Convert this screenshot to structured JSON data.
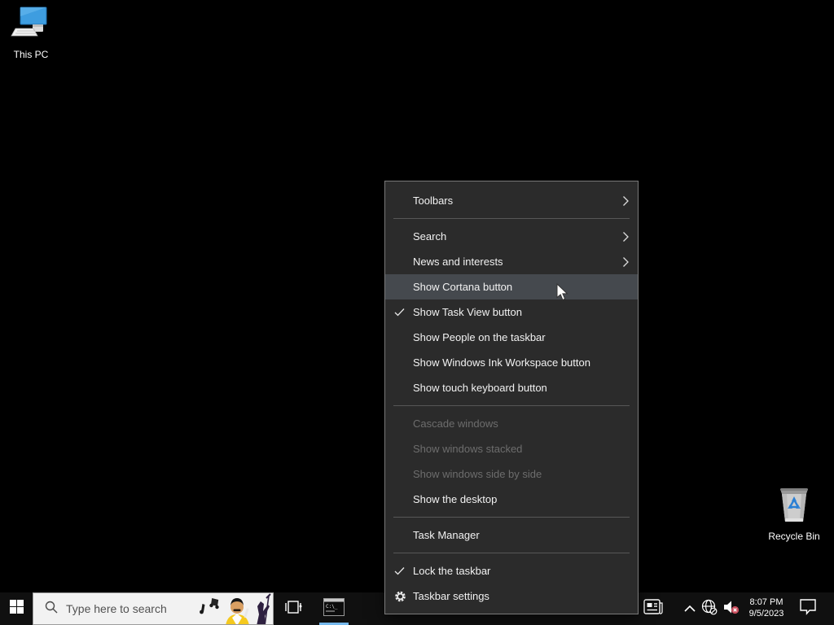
{
  "desktop": {
    "icons": [
      {
        "name": "this-pc",
        "label": "This PC"
      },
      {
        "name": "recycle-bin",
        "label": "Recycle Bin"
      }
    ]
  },
  "context_menu": {
    "items": [
      {
        "label": "Toolbars",
        "type": "submenu"
      },
      {
        "label": "Search",
        "type": "submenu"
      },
      {
        "label": "News and interests",
        "type": "submenu"
      },
      {
        "label": "Show Cortana button",
        "state": "hovered"
      },
      {
        "label": "Show Task View button",
        "state": "checked"
      },
      {
        "label": "Show People on the taskbar"
      },
      {
        "label": "Show Windows Ink Workspace button"
      },
      {
        "label": "Show touch keyboard button"
      },
      {
        "label": "Cascade windows",
        "state": "disabled"
      },
      {
        "label": "Show windows stacked",
        "state": "disabled"
      },
      {
        "label": "Show windows side by side",
        "state": "disabled"
      },
      {
        "label": "Show the desktop"
      },
      {
        "label": "Task Manager"
      },
      {
        "label": "Lock the taskbar",
        "state": "checked"
      },
      {
        "label": "Taskbar settings",
        "icon": "gear-icon"
      }
    ]
  },
  "taskbar": {
    "start_icon": "windows-logo",
    "search": {
      "placeholder": "Type here to search",
      "icon": "search-icon",
      "highlight_art": "freddie-mercury-search-highlight"
    },
    "buttons": [
      {
        "name": "task-view",
        "icon": "task-view-icon"
      },
      {
        "name": "command-prompt",
        "icon": "cmd-window-icon",
        "active": true
      }
    ],
    "tray": {
      "icons": [
        "news-and-interests-icon",
        "chevron-up-icon",
        "network-globe-offline-icon",
        "volume-muted-icon",
        "action-center-icon"
      ],
      "clock": {
        "time": "8:07 PM",
        "date": "9/5/2023"
      }
    }
  },
  "colors": {
    "desktop_bg": "#000000",
    "taskbar_bg": "#101010",
    "menu_bg": "#2b2b2b",
    "menu_hover": "#45494e",
    "menu_border": "#7a7a7a",
    "menu_text": "#f2f2f2",
    "menu_disabled": "#6d6d6d",
    "separator": "#575757",
    "active_app_underline": "#76b9ed",
    "search_bg": "#f2f2f2",
    "volume_badge": "#c94f5e"
  }
}
